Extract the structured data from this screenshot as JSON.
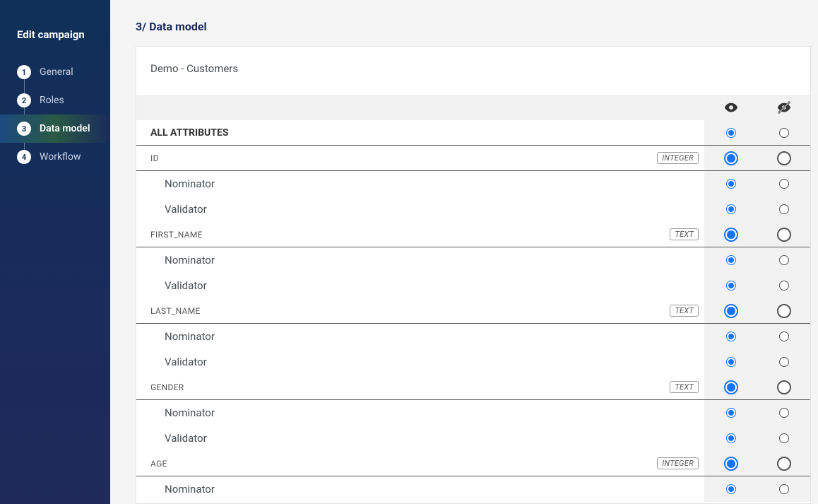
{
  "sidebar": {
    "title": "Edit campaign",
    "steps": [
      {
        "num": "1",
        "label": "General",
        "active": false
      },
      {
        "num": "2",
        "label": "Roles",
        "active": false
      },
      {
        "num": "3",
        "label": "Data model",
        "active": true
      },
      {
        "num": "4",
        "label": "Workflow",
        "active": false
      }
    ]
  },
  "page_title": "3/ Data model",
  "card_title": "Demo - Customers",
  "icons": {
    "visible": "eye-icon",
    "hidden": "eye-slash-icon"
  },
  "all_attributes_label": "ALL ATTRIBUTES",
  "all_attributes": {
    "visible": true
  },
  "attributes": [
    {
      "name": "ID",
      "type": "integer",
      "visible": true,
      "roles": [
        {
          "name": "Nominator",
          "visible": true
        },
        {
          "name": "Validator",
          "visible": true
        }
      ]
    },
    {
      "name": "FIRST_NAME",
      "type": "text",
      "visible": true,
      "roles": [
        {
          "name": "Nominator",
          "visible": true
        },
        {
          "name": "Validator",
          "visible": true
        }
      ]
    },
    {
      "name": "LAST_NAME",
      "type": "text",
      "visible": true,
      "roles": [
        {
          "name": "Nominator",
          "visible": true
        },
        {
          "name": "Validator",
          "visible": true
        }
      ]
    },
    {
      "name": "GENDER",
      "type": "text",
      "visible": true,
      "roles": [
        {
          "name": "Nominator",
          "visible": true
        },
        {
          "name": "Validator",
          "visible": true
        }
      ]
    },
    {
      "name": "AGE",
      "type": "integer",
      "visible": true,
      "roles": [
        {
          "name": "Nominator",
          "visible": true
        }
      ]
    }
  ]
}
